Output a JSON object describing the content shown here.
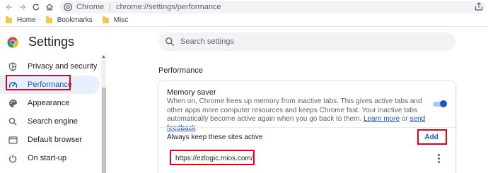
{
  "toolbar": {
    "site_name": "Chrome",
    "url": "chrome://settings/performance"
  },
  "bookmarks": [
    "Home",
    "Bookmarks",
    "Misc"
  ],
  "header": {
    "title": "Settings",
    "search_placeholder": "Search settings"
  },
  "sidebar": {
    "items": [
      {
        "label": "Privacy and security",
        "icon": "shield-icon"
      },
      {
        "label": "Performance",
        "icon": "speedometer-icon",
        "active": true
      },
      {
        "label": "Appearance",
        "icon": "palette-icon"
      },
      {
        "label": "Search engine",
        "icon": "search-icon"
      },
      {
        "label": "Default browser",
        "icon": "browser-window-icon"
      },
      {
        "label": "On start-up",
        "icon": "power-icon"
      }
    ]
  },
  "main": {
    "section_title": "Performance",
    "memory_saver": {
      "title": "Memory saver",
      "description": "When on, Chrome frees up memory from inactive tabs. This gives active tabs and other apps more computer resources and keeps Chrome fast. Your inactive tabs automatically become active again when you go back to them.",
      "learn_more": "Learn more",
      "or": "or",
      "send_feedback": "send feedback",
      "enabled": true
    },
    "keep_active_label": "Always keep these sites active",
    "add_label": "Add",
    "sites": [
      "https://ezlogic.mios.com/"
    ]
  },
  "colors": {
    "accent": "#1a56c4",
    "active_nav_bg": "#e8f0fe",
    "annotation_red": "#e3001b"
  }
}
